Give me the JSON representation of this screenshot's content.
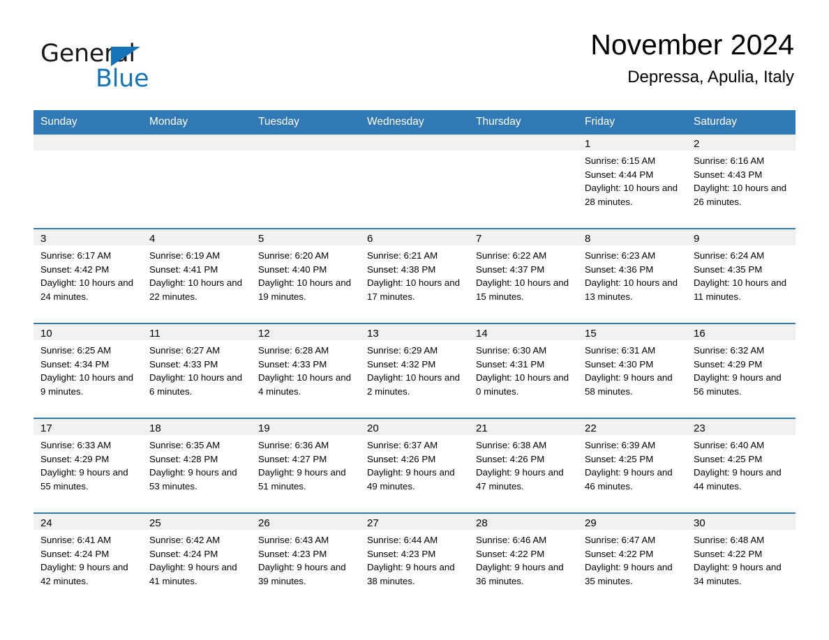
{
  "logo": {
    "text_primary": "General",
    "text_secondary": "Blue",
    "accent_color": "#1574b8",
    "triangle_icon": "triangle-right-icon"
  },
  "header": {
    "month_title": "November 2024",
    "location": "Depressa, Apulia, Italy"
  },
  "colors": {
    "header_blue": "#3079b5",
    "daynum_band": "#f1f1f1",
    "row_separator": "#3079b5",
    "text": "#000000"
  },
  "weekday_headers": [
    "Sunday",
    "Monday",
    "Tuesday",
    "Wednesday",
    "Thursday",
    "Friday",
    "Saturday"
  ],
  "labels": {
    "sunrise_prefix": "Sunrise:",
    "sunset_prefix": "Sunset:",
    "daylight_prefix": "Daylight:"
  },
  "weeks": [
    [
      {
        "day": "",
        "empty": true
      },
      {
        "day": "",
        "empty": true
      },
      {
        "day": "",
        "empty": true
      },
      {
        "day": "",
        "empty": true
      },
      {
        "day": "",
        "empty": true
      },
      {
        "day": "1",
        "sunrise": "Sunrise: 6:15 AM",
        "sunset": "Sunset: 4:44 PM",
        "daylight": "Daylight: 10 hours and 28 minutes."
      },
      {
        "day": "2",
        "sunrise": "Sunrise: 6:16 AM",
        "sunset": "Sunset: 4:43 PM",
        "daylight": "Daylight: 10 hours and 26 minutes."
      }
    ],
    [
      {
        "day": "3",
        "sunrise": "Sunrise: 6:17 AM",
        "sunset": "Sunset: 4:42 PM",
        "daylight": "Daylight: 10 hours and 24 minutes."
      },
      {
        "day": "4",
        "sunrise": "Sunrise: 6:19 AM",
        "sunset": "Sunset: 4:41 PM",
        "daylight": "Daylight: 10 hours and 22 minutes."
      },
      {
        "day": "5",
        "sunrise": "Sunrise: 6:20 AM",
        "sunset": "Sunset: 4:40 PM",
        "daylight": "Daylight: 10 hours and 19 minutes."
      },
      {
        "day": "6",
        "sunrise": "Sunrise: 6:21 AM",
        "sunset": "Sunset: 4:38 PM",
        "daylight": "Daylight: 10 hours and 17 minutes."
      },
      {
        "day": "7",
        "sunrise": "Sunrise: 6:22 AM",
        "sunset": "Sunset: 4:37 PM",
        "daylight": "Daylight: 10 hours and 15 minutes."
      },
      {
        "day": "8",
        "sunrise": "Sunrise: 6:23 AM",
        "sunset": "Sunset: 4:36 PM",
        "daylight": "Daylight: 10 hours and 13 minutes."
      },
      {
        "day": "9",
        "sunrise": "Sunrise: 6:24 AM",
        "sunset": "Sunset: 4:35 PM",
        "daylight": "Daylight: 10 hours and 11 minutes."
      }
    ],
    [
      {
        "day": "10",
        "sunrise": "Sunrise: 6:25 AM",
        "sunset": "Sunset: 4:34 PM",
        "daylight": "Daylight: 10 hours and 9 minutes."
      },
      {
        "day": "11",
        "sunrise": "Sunrise: 6:27 AM",
        "sunset": "Sunset: 4:33 PM",
        "daylight": "Daylight: 10 hours and 6 minutes."
      },
      {
        "day": "12",
        "sunrise": "Sunrise: 6:28 AM",
        "sunset": "Sunset: 4:33 PM",
        "daylight": "Daylight: 10 hours and 4 minutes."
      },
      {
        "day": "13",
        "sunrise": "Sunrise: 6:29 AM",
        "sunset": "Sunset: 4:32 PM",
        "daylight": "Daylight: 10 hours and 2 minutes."
      },
      {
        "day": "14",
        "sunrise": "Sunrise: 6:30 AM",
        "sunset": "Sunset: 4:31 PM",
        "daylight": "Daylight: 10 hours and 0 minutes."
      },
      {
        "day": "15",
        "sunrise": "Sunrise: 6:31 AM",
        "sunset": "Sunset: 4:30 PM",
        "daylight": "Daylight: 9 hours and 58 minutes."
      },
      {
        "day": "16",
        "sunrise": "Sunrise: 6:32 AM",
        "sunset": "Sunset: 4:29 PM",
        "daylight": "Daylight: 9 hours and 56 minutes."
      }
    ],
    [
      {
        "day": "17",
        "sunrise": "Sunrise: 6:33 AM",
        "sunset": "Sunset: 4:29 PM",
        "daylight": "Daylight: 9 hours and 55 minutes."
      },
      {
        "day": "18",
        "sunrise": "Sunrise: 6:35 AM",
        "sunset": "Sunset: 4:28 PM",
        "daylight": "Daylight: 9 hours and 53 minutes."
      },
      {
        "day": "19",
        "sunrise": "Sunrise: 6:36 AM",
        "sunset": "Sunset: 4:27 PM",
        "daylight": "Daylight: 9 hours and 51 minutes."
      },
      {
        "day": "20",
        "sunrise": "Sunrise: 6:37 AM",
        "sunset": "Sunset: 4:26 PM",
        "daylight": "Daylight: 9 hours and 49 minutes."
      },
      {
        "day": "21",
        "sunrise": "Sunrise: 6:38 AM",
        "sunset": "Sunset: 4:26 PM",
        "daylight": "Daylight: 9 hours and 47 minutes."
      },
      {
        "day": "22",
        "sunrise": "Sunrise: 6:39 AM",
        "sunset": "Sunset: 4:25 PM",
        "daylight": "Daylight: 9 hours and 46 minutes."
      },
      {
        "day": "23",
        "sunrise": "Sunrise: 6:40 AM",
        "sunset": "Sunset: 4:25 PM",
        "daylight": "Daylight: 9 hours and 44 minutes."
      }
    ],
    [
      {
        "day": "24",
        "sunrise": "Sunrise: 6:41 AM",
        "sunset": "Sunset: 4:24 PM",
        "daylight": "Daylight: 9 hours and 42 minutes."
      },
      {
        "day": "25",
        "sunrise": "Sunrise: 6:42 AM",
        "sunset": "Sunset: 4:24 PM",
        "daylight": "Daylight: 9 hours and 41 minutes."
      },
      {
        "day": "26",
        "sunrise": "Sunrise: 6:43 AM",
        "sunset": "Sunset: 4:23 PM",
        "daylight": "Daylight: 9 hours and 39 minutes."
      },
      {
        "day": "27",
        "sunrise": "Sunrise: 6:44 AM",
        "sunset": "Sunset: 4:23 PM",
        "daylight": "Daylight: 9 hours and 38 minutes."
      },
      {
        "day": "28",
        "sunrise": "Sunrise: 6:46 AM",
        "sunset": "Sunset: 4:22 PM",
        "daylight": "Daylight: 9 hours and 36 minutes."
      },
      {
        "day": "29",
        "sunrise": "Sunrise: 6:47 AM",
        "sunset": "Sunset: 4:22 PM",
        "daylight": "Daylight: 9 hours and 35 minutes."
      },
      {
        "day": "30",
        "sunrise": "Sunrise: 6:48 AM",
        "sunset": "Sunset: 4:22 PM",
        "daylight": "Daylight: 9 hours and 34 minutes."
      }
    ]
  ]
}
